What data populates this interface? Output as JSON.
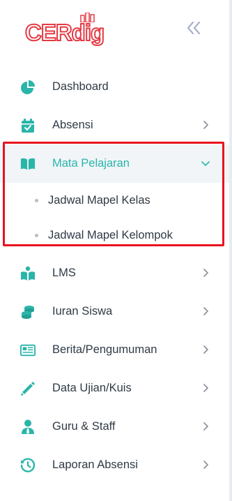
{
  "brand": {
    "logo_text": "CERdig",
    "accent_color": "#e53a44",
    "icon_color": "#2ab5a9"
  },
  "sidebar": {
    "collapse_icon": "double-chevron-left-icon",
    "items": [
      {
        "label": "Dashboard",
        "icon": "pie-chart-icon",
        "has_chevron": false
      },
      {
        "label": "Absensi",
        "icon": "calendar-check-icon",
        "has_chevron": true,
        "chevron": "chevron-right"
      },
      {
        "label": "Mata Pelajaran",
        "icon": "book-open-icon",
        "has_chevron": true,
        "chevron": "chevron-down",
        "active": true,
        "children": [
          {
            "label": "Jadwal Mapel Kelas"
          },
          {
            "label": "Jadwal Mapel Kelompok"
          }
        ]
      },
      {
        "label": "LMS",
        "icon": "reader-icon",
        "has_chevron": true,
        "chevron": "chevron-right"
      },
      {
        "label": "Iuran Siswa",
        "icon": "coins-icon",
        "has_chevron": true,
        "chevron": "chevron-right"
      },
      {
        "label": "Berita/Pengumuman",
        "icon": "newspaper-icon",
        "has_chevron": true,
        "chevron": "chevron-right"
      },
      {
        "label": "Data Ujian/Kuis",
        "icon": "pencil-icon",
        "has_chevron": true,
        "chevron": "chevron-right"
      },
      {
        "label": "Guru & Staff",
        "icon": "user-tie-icon",
        "has_chevron": true,
        "chevron": "chevron-right"
      },
      {
        "label": "Laporan Absensi",
        "icon": "history-icon",
        "has_chevron": true,
        "chevron": "chevron-right"
      }
    ]
  }
}
